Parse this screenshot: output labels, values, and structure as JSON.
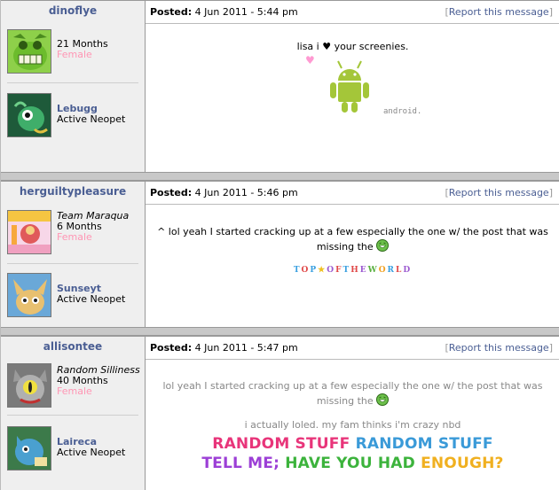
{
  "posts": [
    {
      "author": "dinoflye",
      "account_age": "21 Months",
      "gender": "Female",
      "pet_name": "Lebugg",
      "pet_status": "Active Neopet",
      "posted_label": "Posted:",
      "posted_date": "4 Jun 2011 - 5:44 pm",
      "report_open": "[",
      "report_label": "Report this message",
      "report_close": "]",
      "message": "lisa i ♥ your screenies.",
      "heart": "♥",
      "sig_caption": "android."
    },
    {
      "author": "herguiltypleasure",
      "user_title": "Team Maraqua",
      "account_age": "6 Months",
      "gender": "Female",
      "pet_name": "Sunseyt",
      "pet_status": "Active Neopet",
      "posted_label": "Posted:",
      "posted_date": "4 Jun 2011 - 5:46 pm",
      "report_open": "[",
      "report_label": "Report this message",
      "report_close": "]",
      "message_line1": "^ lol yeah I started cracking up at a few especially the one w/ the post that was",
      "message_line2": "missing the",
      "sig_parts": [
        {
          "text": "T",
          "color": "#3aa0e0"
        },
        {
          "text": "O",
          "color": "#e04848"
        },
        {
          "text": "P",
          "color": "#3aa0e0"
        },
        {
          "text": "★",
          "color": "#f0c020"
        },
        {
          "text": "O",
          "color": "#9b59d0"
        },
        {
          "text": "F",
          "color": "#e04848"
        },
        {
          "text": "T",
          "color": "#3aa0e0"
        },
        {
          "text": "H",
          "color": "#e04848"
        },
        {
          "text": "E",
          "color": "#9b59d0"
        },
        {
          "text": "W",
          "color": "#5ab040"
        },
        {
          "text": "O",
          "color": "#f0a020"
        },
        {
          "text": "R",
          "color": "#3aa0e0"
        },
        {
          "text": "L",
          "color": "#e04848"
        },
        {
          "text": "D",
          "color": "#9b59d0"
        }
      ]
    },
    {
      "author": "allisontee",
      "user_title": "Random Silliness",
      "account_age": "40 Months",
      "gender": "Female",
      "pet_name": "Laireca",
      "pet_status": "Active Neopet",
      "posted_label": "Posted:",
      "posted_date": "4 Jun 2011 - 5:47 pm",
      "report_open": "[",
      "report_label": "Report this message",
      "report_close": "]",
      "quote_line1": "lol yeah I started cracking up at a few especially the one w/ the post that was",
      "quote_line2": "missing the",
      "message": "i actually loled. my fam thinks i'm crazy nbd",
      "sig_line1": [
        {
          "text": "RANDOM STUFF",
          "color": "#e8357a"
        },
        {
          "text": "RANDOM STUFF",
          "color": "#3a9ad8"
        }
      ],
      "sig_line2": [
        {
          "text": "TELL ME;",
          "color": "#9c3fd6"
        },
        {
          "text": "HAVE YOU HAD",
          "color": "#3cb33c"
        },
        {
          "text": "ENOUGH?",
          "color": "#f0b020"
        }
      ]
    }
  ],
  "colors": {
    "username": "#4a5e93",
    "female": "#ff96b4",
    "sidebar_bg": "#efefef",
    "separator": "#c8c8c8"
  }
}
